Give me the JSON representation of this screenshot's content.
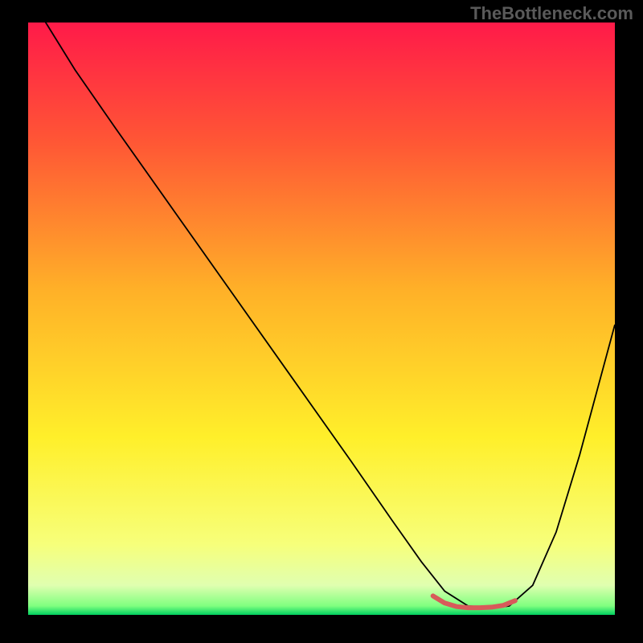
{
  "watermark": "TheBottleneck.com",
  "chart_data": {
    "type": "line",
    "title": "",
    "xlabel": "",
    "ylabel": "",
    "xlim": [
      0,
      100
    ],
    "ylim": [
      0,
      100
    ],
    "grid": false,
    "gradient_stops": [
      {
        "offset": 0,
        "color": "#ff1a49"
      },
      {
        "offset": 20,
        "color": "#ff5635"
      },
      {
        "offset": 45,
        "color": "#ffb028"
      },
      {
        "offset": 70,
        "color": "#ffef2a"
      },
      {
        "offset": 88,
        "color": "#f7ff7a"
      },
      {
        "offset": 95,
        "color": "#e0ffb0"
      },
      {
        "offset": 98.5,
        "color": "#7fff7f"
      },
      {
        "offset": 100,
        "color": "#00d060"
      }
    ],
    "series": [
      {
        "name": "bottleneck-curve",
        "color": "#000000",
        "width": 1.8,
        "x": [
          0,
          3,
          8,
          15,
          25,
          35,
          45,
          55,
          62,
          67,
          71,
          75,
          79,
          82,
          86,
          90,
          94,
          97,
          100
        ],
        "y": [
          105,
          100,
          92,
          82,
          68,
          54,
          40,
          26,
          16,
          9,
          4,
          1.5,
          1.2,
          1.5,
          5,
          14,
          27,
          38,
          49
        ]
      },
      {
        "name": "optimal-marker",
        "color": "#d85a5a",
        "width": 6,
        "style": "rounded",
        "x": [
          69,
          71,
          73,
          75,
          77,
          79,
          81,
          83
        ],
        "y": [
          3.2,
          2.0,
          1.4,
          1.2,
          1.2,
          1.3,
          1.6,
          2.4
        ]
      }
    ]
  }
}
